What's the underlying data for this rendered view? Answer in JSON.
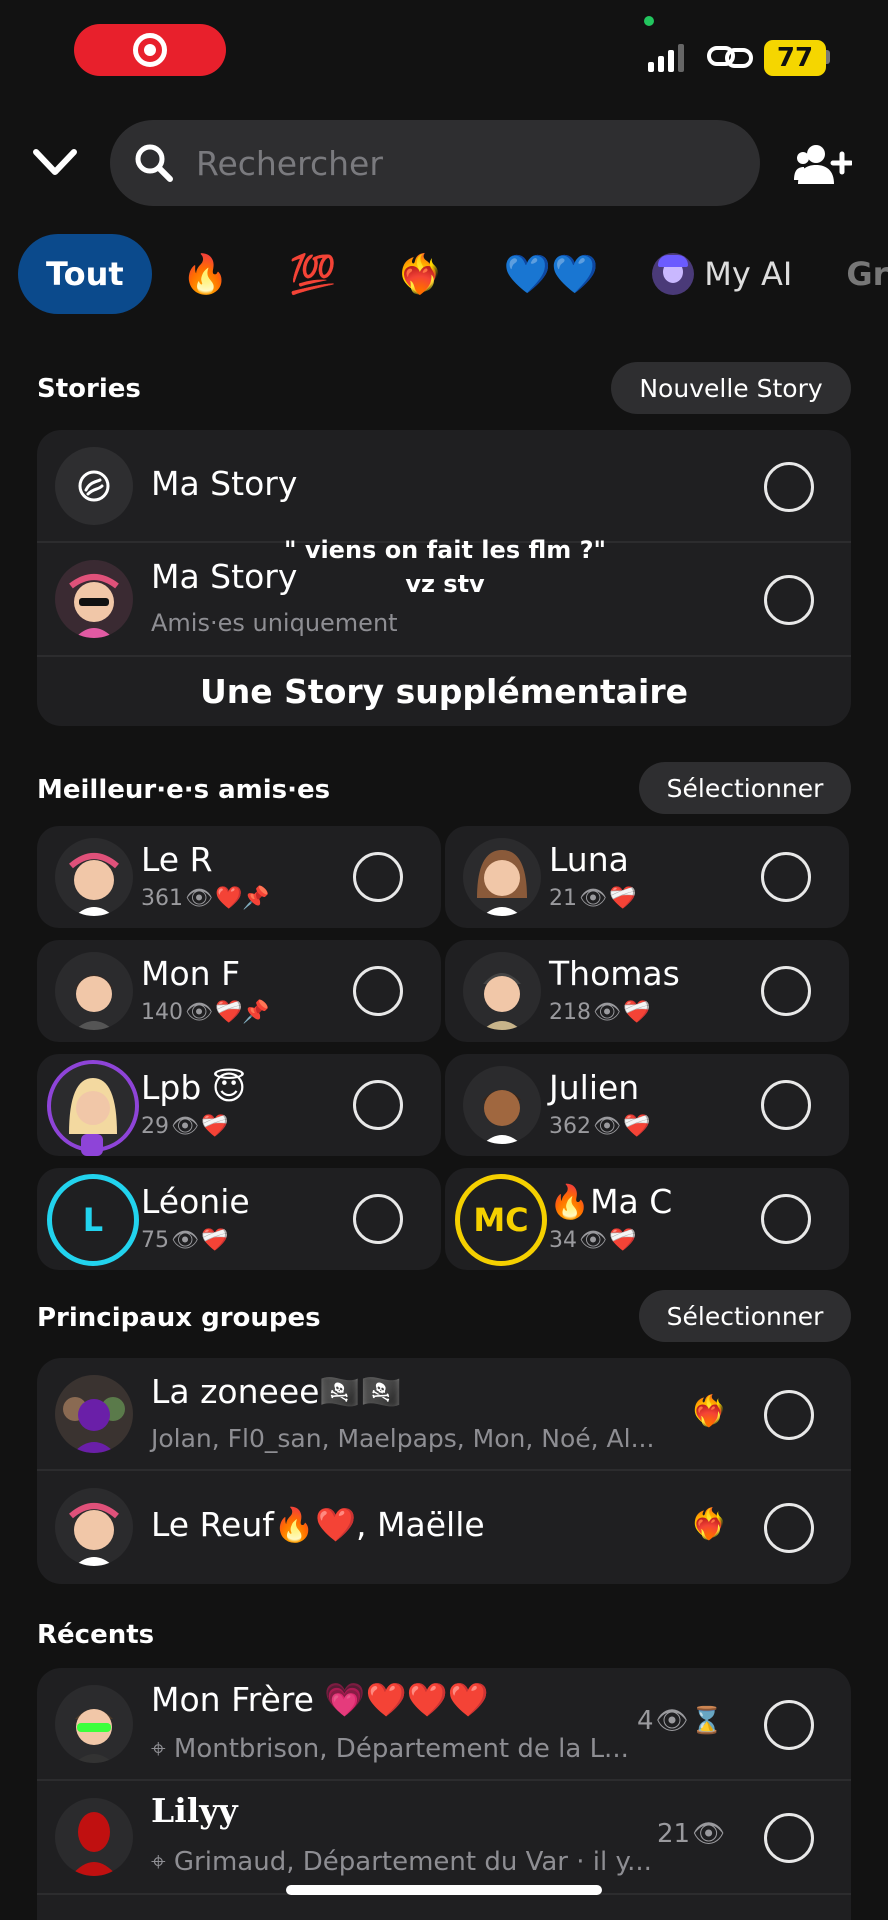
{
  "status_bar": {
    "battery": "77"
  },
  "search": {
    "placeholder": "Rechercher"
  },
  "filters": {
    "all": "Tout",
    "fire": "🔥",
    "hundred": "💯",
    "heart_fire": "❤️‍🔥",
    "blue_hearts": "💙💙",
    "my_ai": "My AI",
    "groups_cut": "Gr"
  },
  "stories": {
    "title": "Stories",
    "new_story_button": "Nouvelle Story",
    "items": [
      {
        "title": "Ma Story"
      },
      {
        "title": "Ma Story",
        "subtitle": "Amis·es uniquement",
        "overlay_line1": "\" viens on fait les flm ?\"",
        "overlay_line2": "vz stv"
      }
    ],
    "extra_story": "Une Story supplémentaire"
  },
  "best_friends": {
    "title": "Meilleur·e·s amis·es",
    "select_button": "Sélectionner",
    "items": [
      {
        "name": "Le R",
        "count": "361",
        "emojis": "❤️📌"
      },
      {
        "name": "Luna",
        "count": "21",
        "emojis": "❤️‍🩹"
      },
      {
        "name": "Mon F",
        "count": "140",
        "emojis": "❤️‍🩹📌"
      },
      {
        "name": "Thomas",
        "count": "218",
        "emojis": "❤️‍🩹"
      },
      {
        "name": "Lpb 😇",
        "count": "29",
        "emojis": "❤️‍🩹"
      },
      {
        "name": "Julien",
        "count": "362",
        "emojis": "❤️‍🩹"
      },
      {
        "name": "Léonie",
        "count": "75",
        "emojis": "❤️‍🩹",
        "initial": "L"
      },
      {
        "name": "🔥Ma C",
        "count": "34",
        "emojis": "❤️‍🩹",
        "initial": "MC"
      }
    ]
  },
  "groups": {
    "title": "Principaux groupes",
    "select_button": "Sélectionner",
    "items": [
      {
        "name": "La zoneee🏴‍☠️🏴‍☠️",
        "members": "Jolan, Fl0_san, Maelpaps, Mon, Noé, Al...",
        "badge": "❤️‍🔥"
      },
      {
        "name": "Le Reuf🔥❤️, Maëlle",
        "badge": "❤️‍🔥"
      }
    ]
  },
  "recents": {
    "title": "Récents",
    "items": [
      {
        "name": "Mon Frère 💗❤️❤️❤️",
        "location": "Montbrison, Département de la L...",
        "count": "4",
        "extra": "⌛"
      },
      {
        "name": "Lilyy",
        "location": "Grimaud, Département du Var · il y...",
        "count": "21"
      }
    ]
  },
  "colors": {
    "background": "#121212",
    "card": "#1f1f21",
    "active_chip": "#0b4a8c",
    "record": "#e8202c",
    "battery": "#f5d600",
    "ring_purple": "#8e44d8",
    "ring_cyan": "#22d3ee",
    "ring_yellow": "#f5d000"
  }
}
